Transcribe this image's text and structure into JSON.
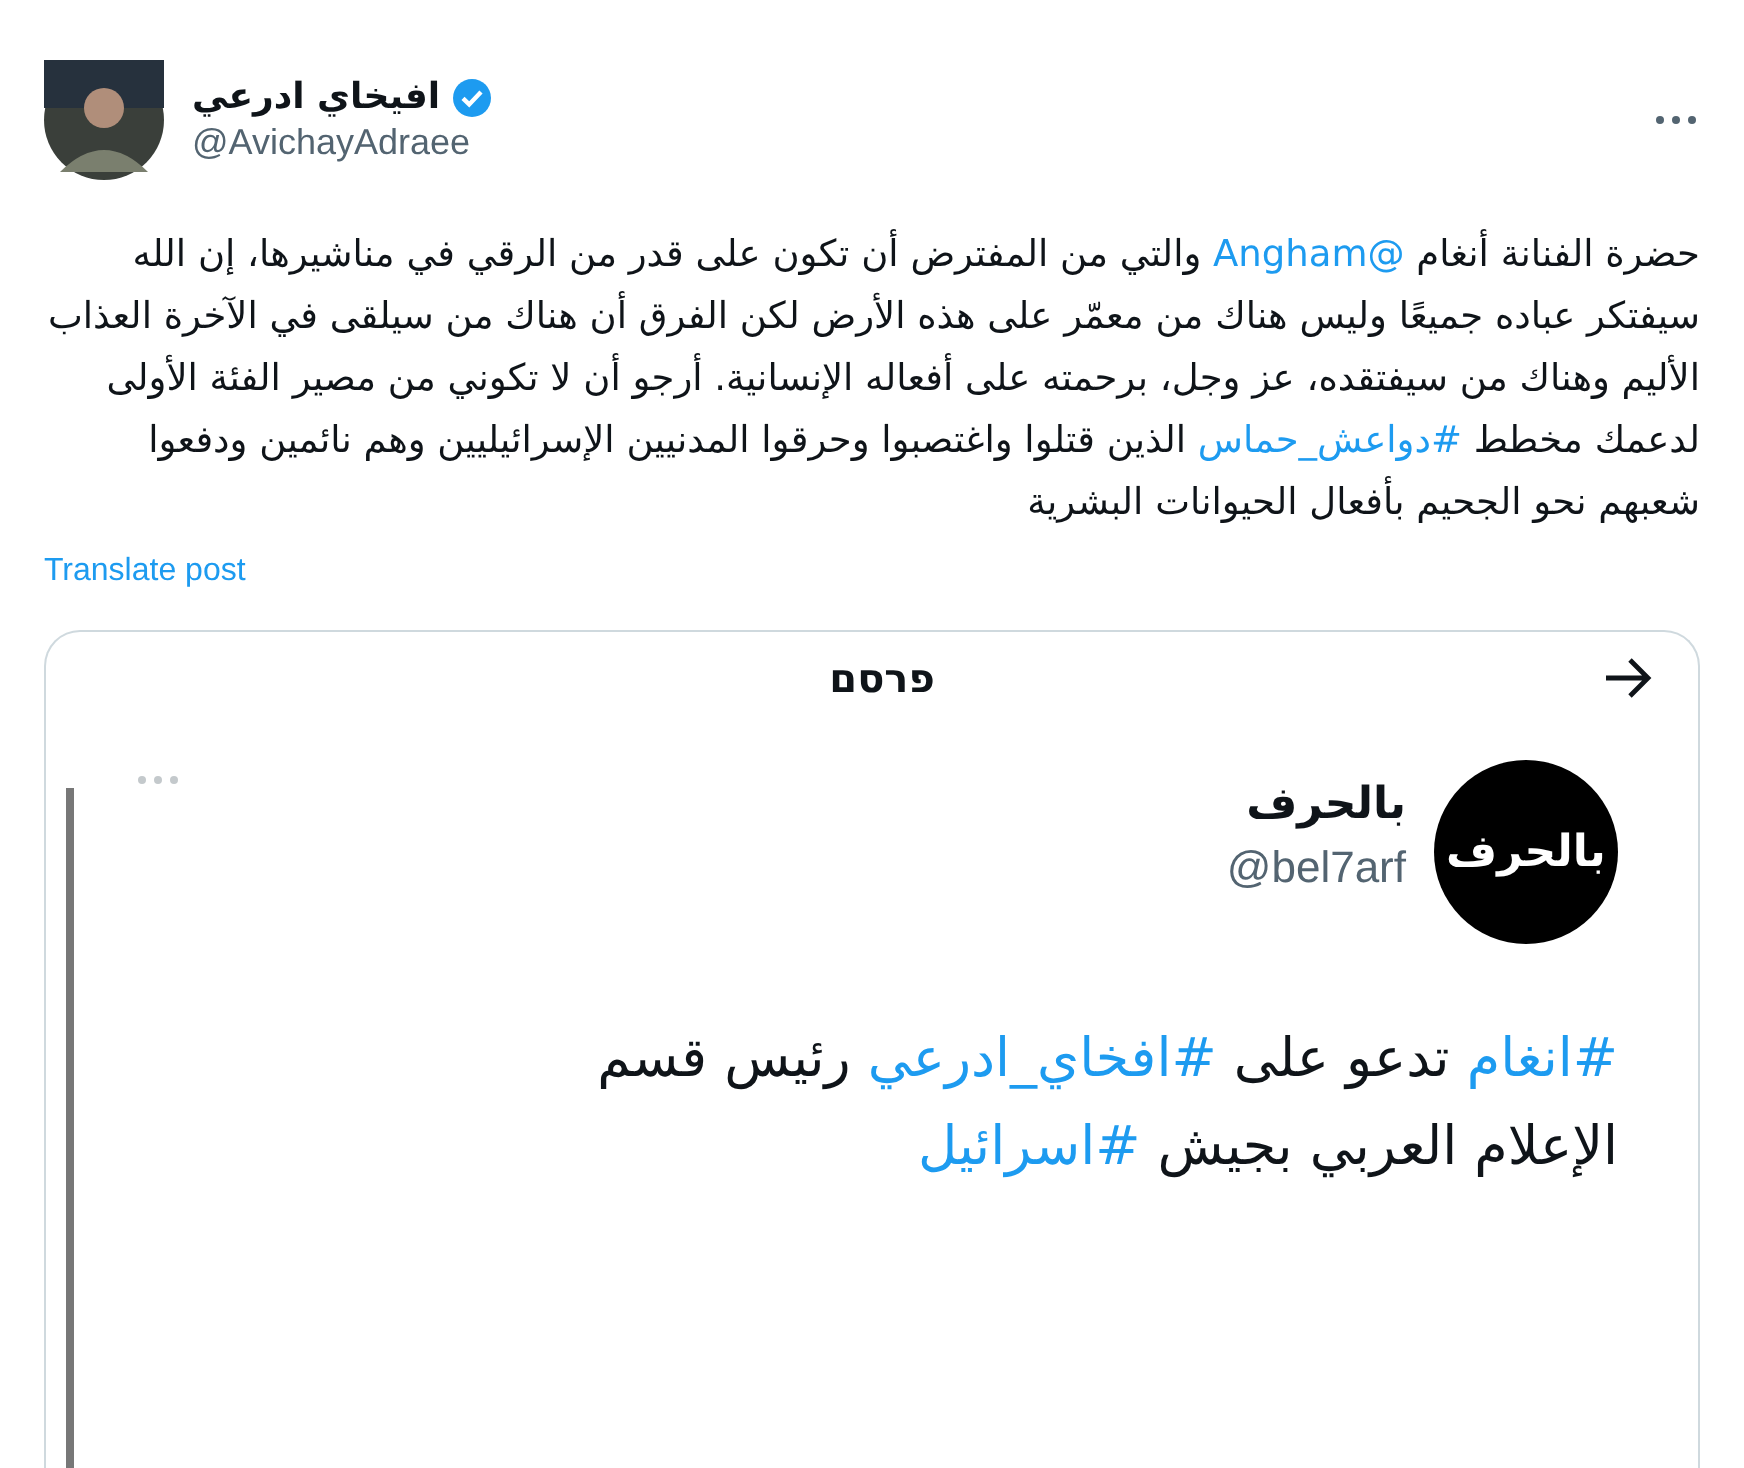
{
  "author": {
    "name": "افيخاي ادرعي",
    "handle": "@AvichayAdraee",
    "verified": true
  },
  "body": [
    {
      "kind": "plain",
      "text": "حضرة الفنانة أنغام "
    },
    {
      "kind": "link",
      "text": "@Angham"
    },
    {
      "kind": "plain",
      "text": " والتي من المفترض أن تكون على قدر من الرقي في مناشيرها، إن الله سيفتكر عباده جميعًا وليس هناك من معمّر على هذه الأرض لكن الفرق أن هناك من سيلقى في الآخرة العذاب الأليم وهناك من سيفتقده، عز وجل، برحمته على أفعاله الإنسانية. أرجو أن لا تكوني من مصير الفئة الأولى لدعمك مخطط "
    },
    {
      "kind": "link",
      "text": "#دواعش_حماس"
    },
    {
      "kind": "plain",
      "text": " الذين قتلوا واغتصبوا وحرقوا المدنيين الإسرائيليين وهم نائمين ودفعوا شعبهم نحو الجحيم بأفعال الحيوانات البشرية"
    }
  ],
  "translate_link": "Translate post",
  "quoted": {
    "header": "פרסם",
    "logo_text": "بالحرف",
    "name": "بالحرف",
    "handle": "@bel7arf",
    "body": [
      {
        "kind": "link",
        "text": "#انغام"
      },
      {
        "kind": "plain",
        "text": " تدعو على "
      },
      {
        "kind": "link",
        "text": "#افخاي_ادرعي"
      },
      {
        "kind": "plain",
        "text": " رئيس قسم الإعلام العربي بجيش "
      },
      {
        "kind": "link",
        "text": "#اسرائيل"
      }
    ]
  }
}
